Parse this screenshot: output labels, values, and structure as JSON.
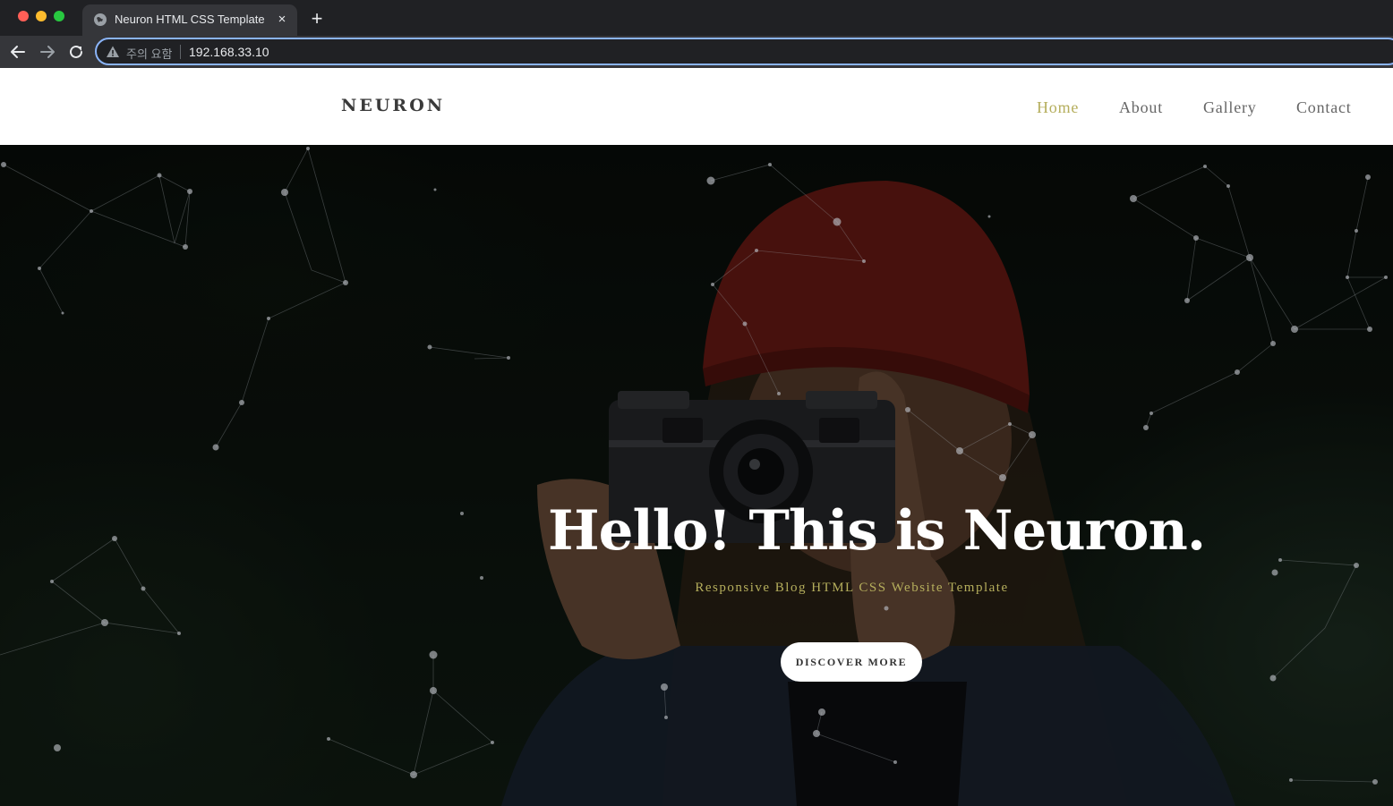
{
  "browser": {
    "tab_title": "Neuron HTML CSS Template",
    "close_glyph": "×",
    "new_tab_glyph": "+",
    "security_text": "주의 요함",
    "url": "192.168.33.10",
    "icons": [
      "globe-icon",
      "close-icon",
      "plus-icon",
      "back-arrow-icon",
      "forward-arrow-icon",
      "reload-icon",
      "warning-icon"
    ]
  },
  "site": {
    "logo": "NEURON",
    "nav": {
      "home": "Home",
      "about": "About",
      "gallery": "Gallery",
      "contact": "Contact",
      "active": "Home"
    },
    "colors": {
      "accent": "#b5ae5c",
      "nav_text": "#666666",
      "header_bg": "#ffffff"
    }
  },
  "hero": {
    "title": "Hello! This is Neuron.",
    "subtitle": "Responsive Blog HTML CSS Website Template",
    "button_label": "DISCOVER MORE",
    "colors": {
      "title": "#ffffff",
      "subtitle": "#b5ae5c",
      "button_bg": "#ffffff"
    }
  }
}
